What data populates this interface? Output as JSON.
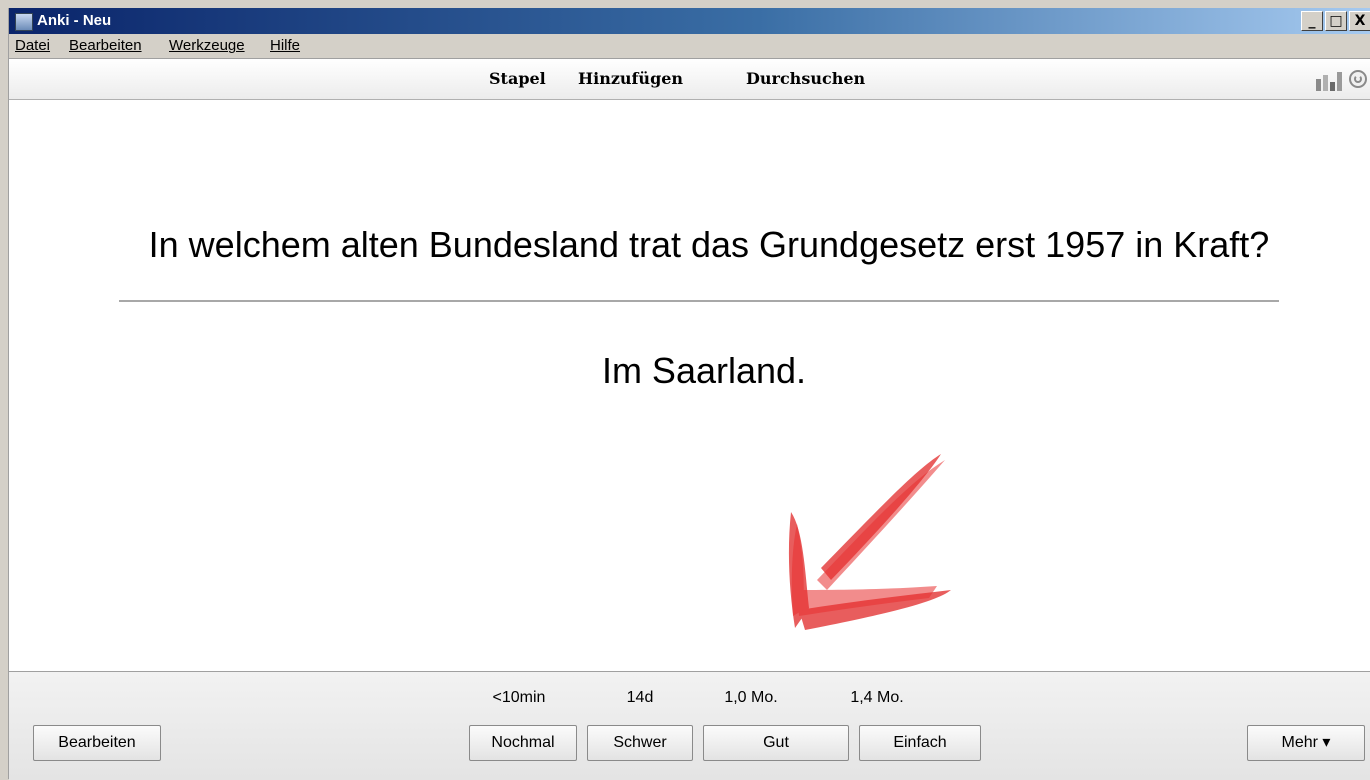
{
  "window": {
    "title": "Anki - Neu",
    "controls": {
      "minimize": "_",
      "maximize": "□",
      "close": "X"
    }
  },
  "menu": [
    "Datei",
    "Bearbeiten",
    "Werkzeuge",
    "Hilfe"
  ],
  "toolbar": {
    "links": [
      "Stapel",
      "Hinzufügen",
      "Durchsuchen"
    ],
    "icons": [
      "stats-icon",
      "sync-icon"
    ]
  },
  "card": {
    "question": "In welchem alten Bundesland trat das Grundgesetz erst 1957 in Kraft?",
    "answer": "Im Saarland.",
    "annotation": {
      "icon": "red-arrow",
      "color": "#e02020"
    }
  },
  "bottom": {
    "edit_label": "Bearbeiten",
    "more_label": "Mehr ▾",
    "ease_buttons": [
      {
        "label": "Nochmal",
        "interval": "<10min"
      },
      {
        "label": "Schwer",
        "interval": "14d"
      },
      {
        "label": "Gut",
        "interval": "1,0 Mo."
      },
      {
        "label": "Einfach",
        "interval": "1,4 Mo."
      }
    ]
  }
}
